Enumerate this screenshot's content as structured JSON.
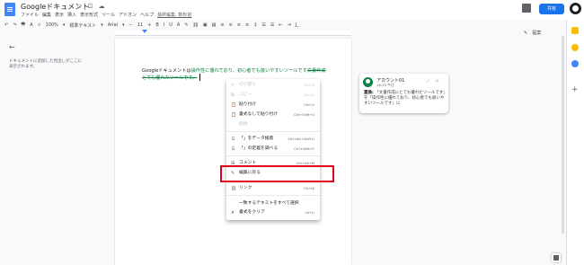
{
  "app": {
    "title": "Googleドキュメント",
    "title_icons": "☆ ⊡ ☁",
    "share_label": "共有"
  },
  "menubar": [
    "ファイル",
    "編集",
    "表示",
    "挿入",
    "表示形式",
    "ツール",
    "アドオン",
    "ヘルプ"
  ],
  "last_edit": "最終編集: 数秒前",
  "toolbar": {
    "items": [
      "↶",
      "↷",
      "🖶",
      "A",
      "⟐",
      "100%",
      "▾",
      "標準テキスト",
      "▾",
      "Arial",
      "▾",
      "−",
      "11",
      "+",
      "B",
      "I",
      "U",
      "A",
      "✎",
      "⛓",
      "▣",
      "▨",
      "≡",
      "≡",
      "≡",
      "≡",
      "↕",
      "☰",
      "☰",
      "⇤",
      "⇥",
      "I͟"
    ],
    "mode": "提案",
    "mode_icon": "✎"
  },
  "outline": {
    "back": "←",
    "text": "ドキュメントに追加した見出しがここに表示されます。"
  },
  "document": {
    "line1_a": "Googleドキュメントは",
    "line1_b": "操作性に優れており、初心者でも扱いやすいツールです",
    "line1_c": "文書作成",
    "line2": "とても優れたツールです。"
  },
  "comment": {
    "author": "アカウント01",
    "time": "16:15 今日",
    "accept": "✓",
    "reject": "✕",
    "label": "置換:",
    "body": "「文書作成にとても優れたツールです」を「操作性に優れており、初心者でも扱いやすいツールです」に"
  },
  "context_menu": {
    "items": [
      {
        "icon": "✂",
        "label": "切り取り",
        "shortcut": "Ctrl+X",
        "disabled": true
      },
      {
        "icon": "⧉",
        "label": "コピー",
        "shortcut": "Ctrl+C",
        "disabled": true
      },
      {
        "icon": "📋",
        "label": "貼り付け",
        "shortcut": "Ctrl+V",
        "disabled": false
      },
      {
        "icon": "📋",
        "label": "書式なしで貼り付け",
        "shortcut": "Ctrl+Shift+V",
        "disabled": false
      },
      {
        "icon": "",
        "label": "削除",
        "shortcut": "",
        "disabled": true
      },
      {
        "icon": "Ｇ",
        "label": "「」をデータ検索",
        "shortcut": "Ctrl+Alt+Shift+I",
        "disabled": false
      },
      {
        "icon": "Ｇ",
        "label": "「」の定義を調べる",
        "shortcut": "Ctrl+Shift+Y",
        "disabled": false
      },
      {
        "icon": "⊞",
        "label": "コメント",
        "shortcut": "Ctrl+Alt+M",
        "disabled": false
      },
      {
        "icon": "✎",
        "label": "編集に戻る",
        "shortcut": "",
        "disabled": false
      },
      {
        "icon": "⛓",
        "label": "リンク",
        "shortcut": "Ctrl+K",
        "disabled": false
      },
      {
        "icon": "",
        "label": "一致するテキストをすべて選択",
        "shortcut": "",
        "disabled": false
      },
      {
        "icon": "✗",
        "label": "書式をクリア",
        "shortcut": "Ctrl+\\",
        "disabled": false
      }
    ]
  },
  "side_panel": {
    "add": "+"
  },
  "colors": {
    "brand_blue": "#1a73e8",
    "suggestion_green": "#0b8043",
    "highlight_red": "#e0001b"
  }
}
